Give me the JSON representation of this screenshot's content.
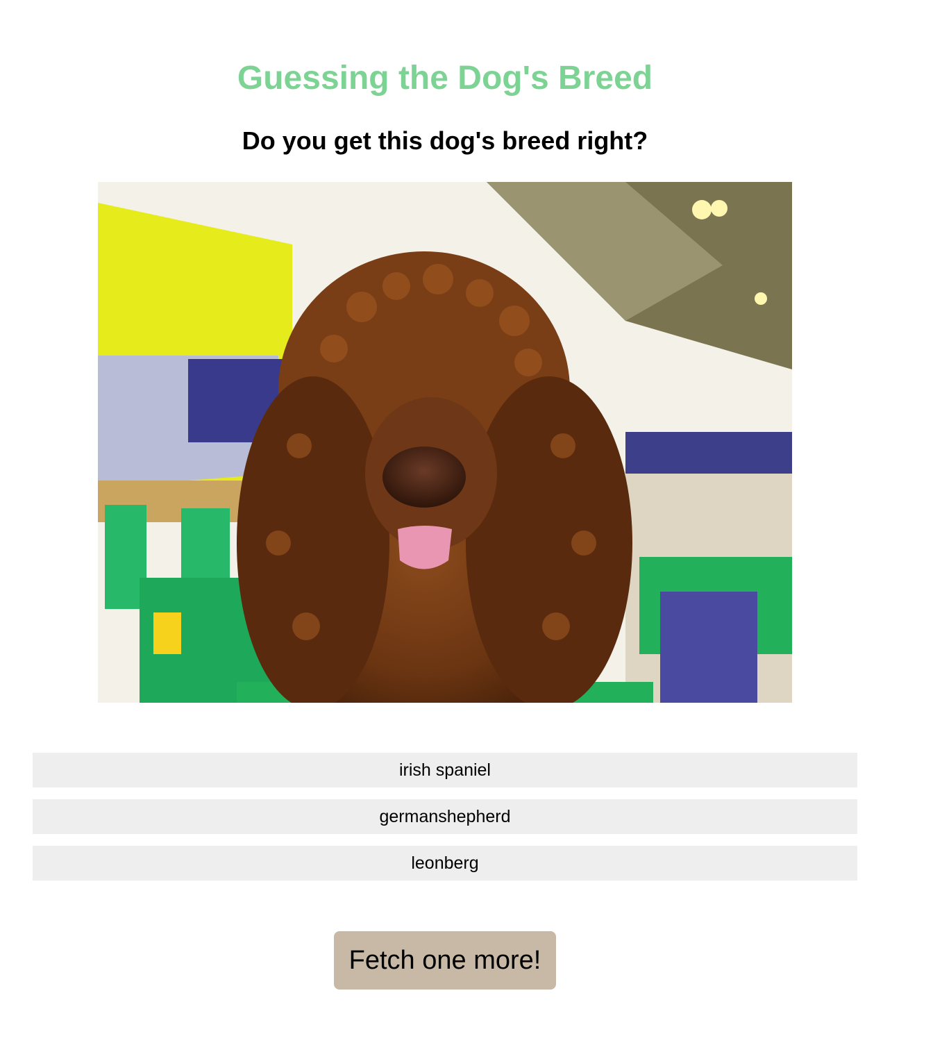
{
  "header": {
    "title": "Guessing the Dog's Breed",
    "subtitle": "Do you get this dog's breed right?"
  },
  "photo": {
    "subject": "dog-photo"
  },
  "options": [
    {
      "label": "irish spaniel"
    },
    {
      "label": "germanshepherd"
    },
    {
      "label": "leonberg"
    }
  ],
  "actions": {
    "fetch_label": "Fetch one more!"
  },
  "colors": {
    "title": "#7dd394",
    "option_background": "#eeeeee",
    "fetch_button": "#c8b8a6"
  }
}
